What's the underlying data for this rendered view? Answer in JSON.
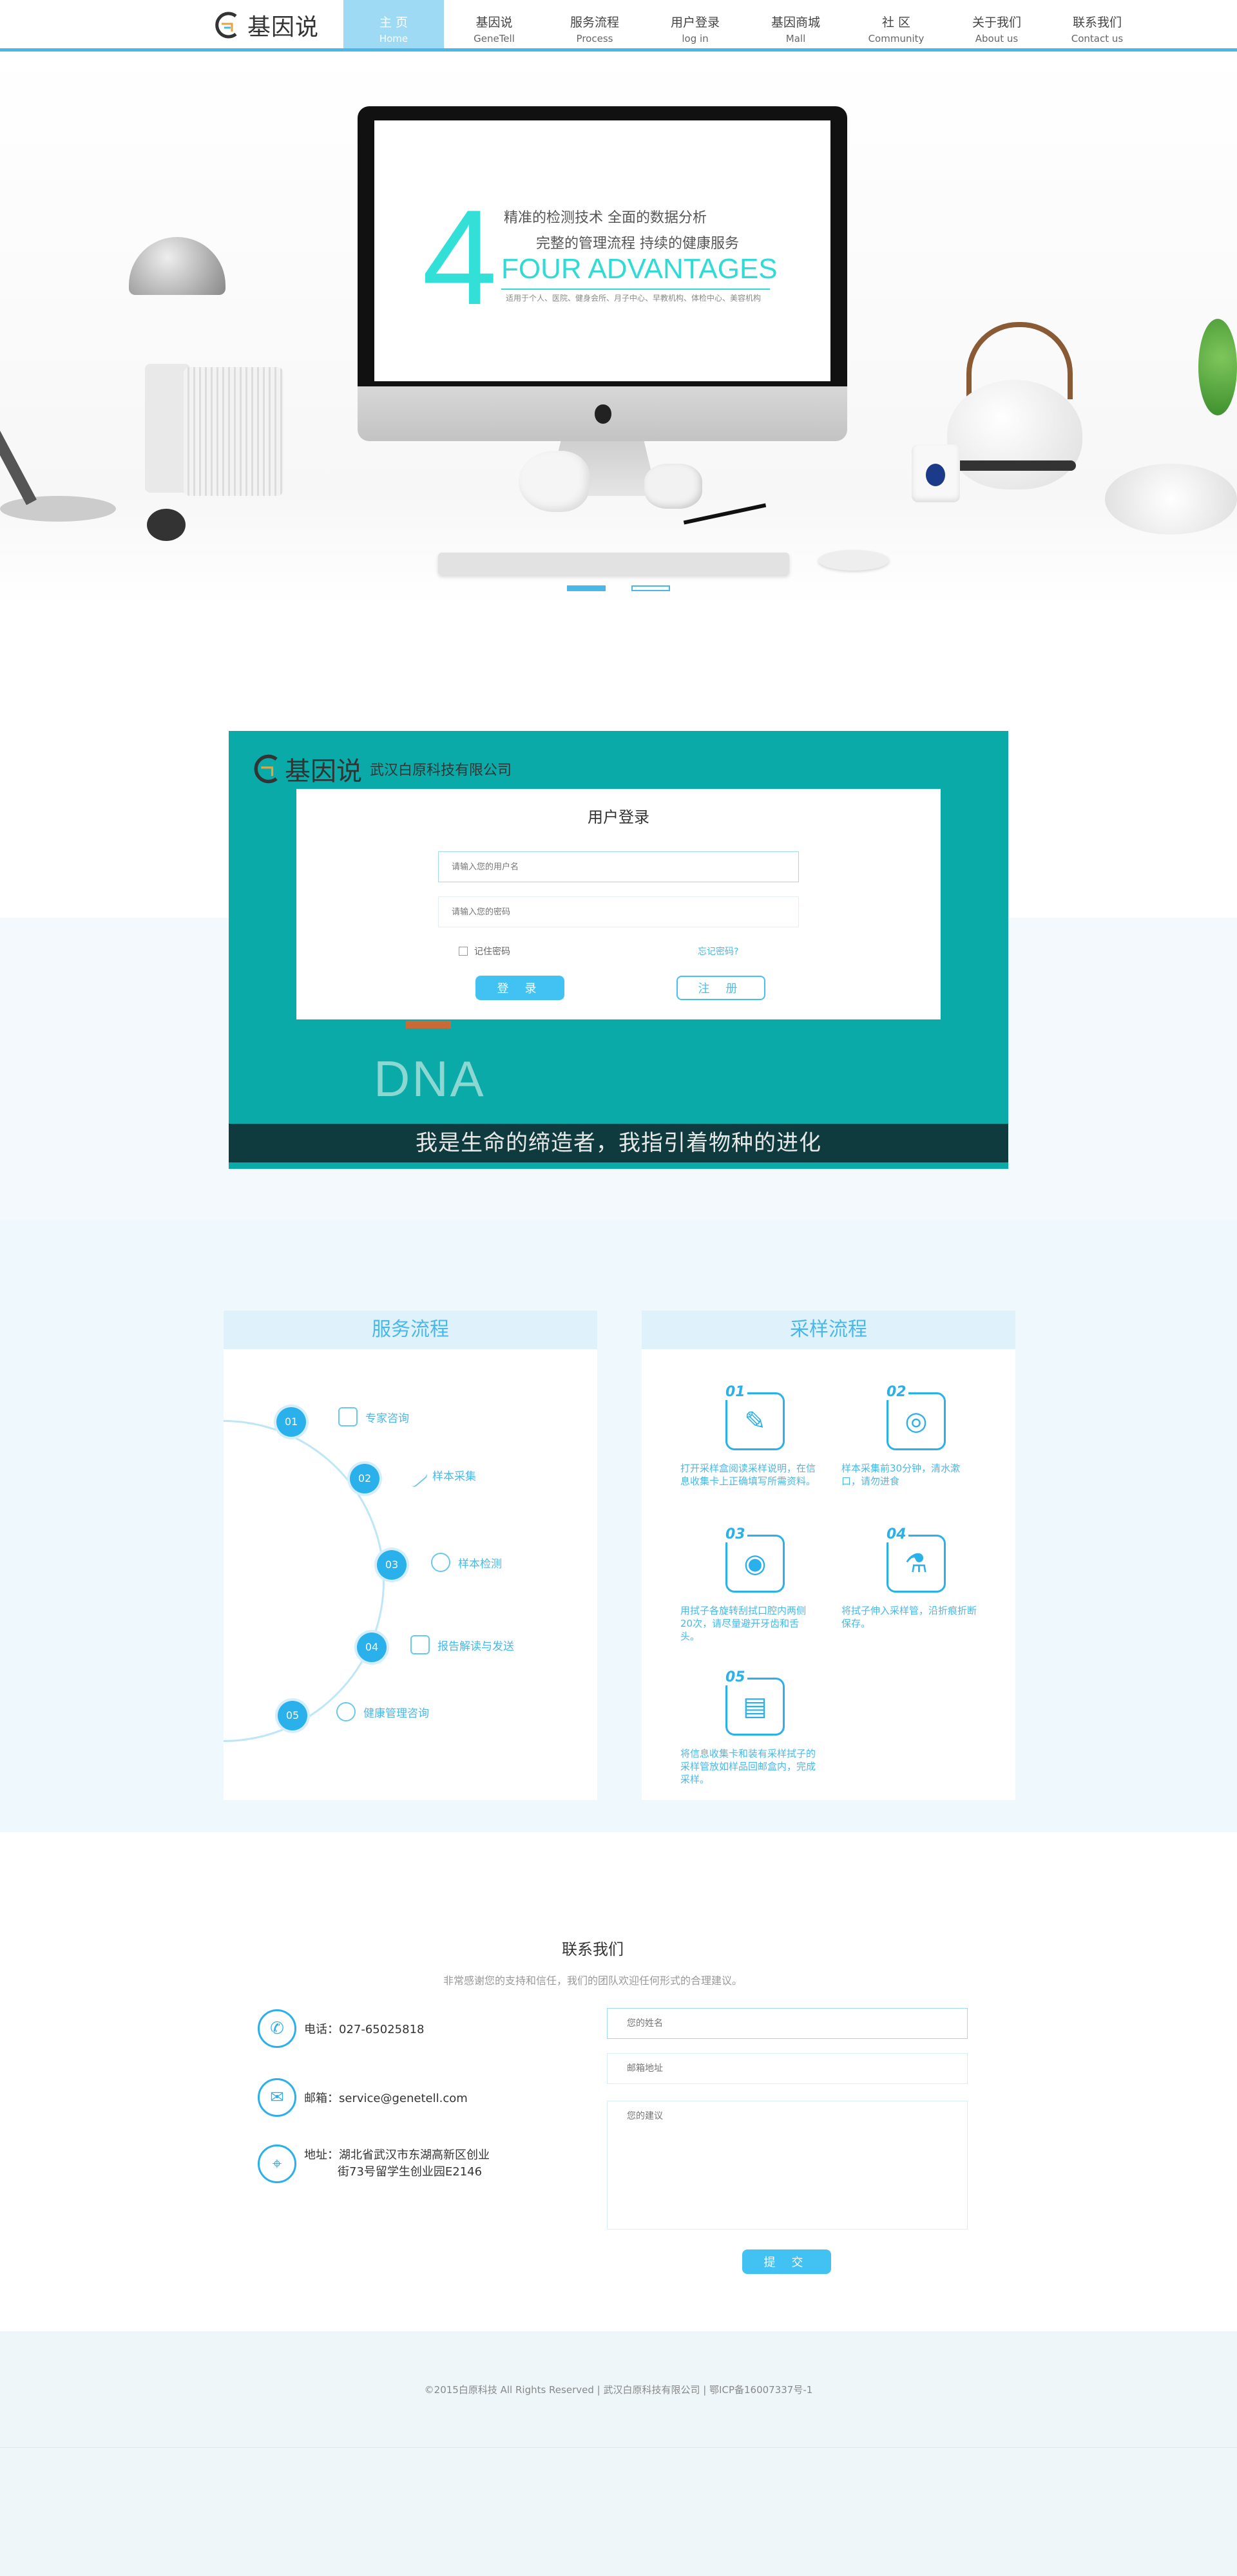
{
  "nav": {
    "logo_text": "基因说",
    "items": [
      {
        "zh": "主  页",
        "en": "Home"
      },
      {
        "zh": "基因说",
        "en": "GeneTell"
      },
      {
        "zh": "服务流程",
        "en": "Process"
      },
      {
        "zh": "用户登录",
        "en": "log in"
      },
      {
        "zh": "基因商城",
        "en": "Mall"
      },
      {
        "zh": "社  区",
        "en": "Community"
      },
      {
        "zh": "关于我们",
        "en": "About us"
      },
      {
        "zh": "联系我们",
        "en": "Contact us"
      }
    ],
    "active_index": 0
  },
  "banner": {
    "big_number": "4",
    "line1": "精准的检测技术   全面的数据分析",
    "line2": "完整的管理流程   持续的健康服务",
    "title": "FOUR ADVANTAGES",
    "subtitle": "适用于个人、医院、健身会所、月子中心、早教机构、体检中心、美容机构"
  },
  "login_section": {
    "logo_text": "基因说",
    "company": "武汉白原科技有限公司",
    "dna_label": "DNA",
    "quote": "我是生命的缔造者，我指引着物种的进化",
    "card": {
      "title": "用户登录",
      "username_placeholder": "请输入您的用户名",
      "password_placeholder": "请输入您的密码",
      "remember_label": "记住密码",
      "forgot_label": "忘记密码?",
      "login_label": "登 录",
      "register_label": "注 册"
    }
  },
  "service_panel": {
    "title": "服务流程",
    "steps": [
      {
        "num": "01",
        "label": "专家咨询"
      },
      {
        "num": "02",
        "label": "样本采集"
      },
      {
        "num": "03",
        "label": "样本检测"
      },
      {
        "num": "04",
        "label": "报告解读与发送"
      },
      {
        "num": "05",
        "label": "健康管理咨询"
      }
    ]
  },
  "sampling_panel": {
    "title": "采样流程",
    "steps": [
      {
        "num": "01",
        "text": "打开采样盒阅读采样说明，在信息收集卡上正确填写所需资料。"
      },
      {
        "num": "02",
        "text": "样本采集前30分钟，清水漱口，请勿进食"
      },
      {
        "num": "03",
        "text": "用拭子各旋转刮拭口腔内两侧20次，请尽量避开牙齿和舌头。"
      },
      {
        "num": "04",
        "text": "将拭子伸入采样管，沿折痕折断保存。"
      },
      {
        "num": "05",
        "text": "将信息收集卡和装有采样拭子的采样管放如样品回邮盒内，完成采样。"
      }
    ]
  },
  "contact": {
    "title": "联系我们",
    "subtitle": "非常感谢您的支持和信任，我们的团队欢迎任何形式的合理建议。",
    "phone": "电话：027-65025818",
    "email": "邮箱：service@genetell.com",
    "address_line1": "地址：湖北省武汉市东湖高新区创业",
    "address_line2": "街73号留学生创业园E2146",
    "name_placeholder": "您的姓名",
    "email_placeholder": "邮箱地址",
    "advice_placeholder": "您的建议",
    "submit_label": "提 交"
  },
  "footer": {
    "copyright": "©2015白原科技 All Rights Reserved  |  武汉白原科技有限公司  |  鄂ICP备16007337号-1"
  },
  "colors": {
    "accent": "#49b8e8",
    "button": "#41c2f2",
    "teal": "#09aaa7",
    "cyan_text": "#31dbd5"
  }
}
